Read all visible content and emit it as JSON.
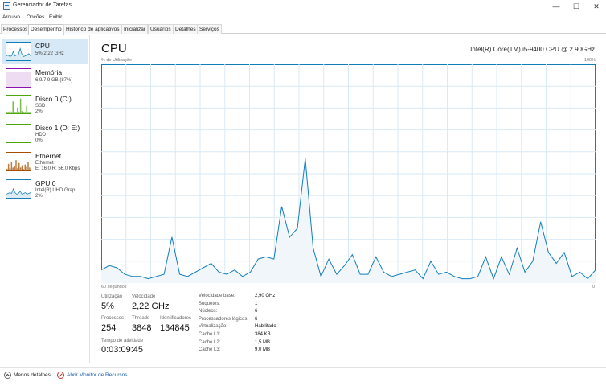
{
  "window": {
    "title": "Gerenciador de Tarefas",
    "controls": {
      "minimize": "—",
      "maximize": "☐",
      "close": "✕"
    }
  },
  "menu": [
    "Arquivo",
    "Opções",
    "Exibir"
  ],
  "tabs": [
    "Processos",
    "Desempenho",
    "Histórico de aplicativos",
    "Inicializar",
    "Usuários",
    "Detalhes",
    "Serviços"
  ],
  "active_tab": "Desempenho",
  "sidebar": {
    "items": [
      {
        "name": "CPU",
        "lines": [
          "5% 2,22 GHz"
        ],
        "color": "#117dbb"
      },
      {
        "name": "Memória",
        "lines": [
          "6,9/7,9 GB (87%)"
        ],
        "color": "#8b12ae"
      },
      {
        "name": "Disco 0 (C:)",
        "lines": [
          "SSD",
          "2%"
        ],
        "color": "#4da60c"
      },
      {
        "name": "Disco 1 (D: E:)",
        "lines": [
          "HDD",
          "0%"
        ],
        "color": "#4da60c"
      },
      {
        "name": "Ethernet",
        "lines": [
          "Ethernet",
          "E: 16,0  R: 56,0 Kbps"
        ],
        "color": "#a74f01"
      },
      {
        "name": "GPU 0",
        "lines": [
          "Intel(R) UHD Grap...",
          "2%"
        ],
        "color": "#1a7fb5"
      }
    ]
  },
  "main": {
    "title": "CPU",
    "cpu_model": "Intel(R) Core(TM) i5-9400 CPU @ 2.90GHz",
    "graph_label": "% de Utilização",
    "graph_max": "100%",
    "graph_min": "0",
    "time_label": "60 segundos",
    "graph_color": "#117dbb"
  },
  "chart_data": {
    "type": "area",
    "xlabel": "60 segundos",
    "ylabel": "% de Utilização",
    "ylim": [
      0,
      100
    ],
    "values": [
      6,
      8,
      7,
      4,
      3,
      3,
      2,
      3,
      4,
      21,
      4,
      3,
      5,
      7,
      9,
      5,
      4,
      6,
      3,
      5,
      11,
      12,
      11,
      35,
      21,
      25,
      57,
      16,
      3,
      11,
      4,
      8,
      13,
      4,
      4,
      12,
      5,
      3,
      4,
      5,
      6,
      2,
      10,
      4,
      5,
      3,
      2,
      2,
      3,
      12,
      2,
      12,
      4,
      16,
      5,
      10,
      28,
      14,
      9,
      14,
      3,
      5,
      2,
      6
    ]
  },
  "stats": {
    "utilizacao": {
      "label": "Utilização",
      "value": "5%"
    },
    "velocidade": {
      "label": "Velocidade",
      "value": "2,22 GHz"
    },
    "processos": {
      "label": "Processos",
      "value": "254"
    },
    "threads": {
      "label": "Threads",
      "value": "3848"
    },
    "identificadores": {
      "label": "Identificadores",
      "value": "134845"
    },
    "tempo": {
      "label": "Tempo de atividade",
      "value": "0:03:09:45"
    }
  },
  "specs": [
    {
      "key": "Velocidade base:",
      "value": "2,90 GHz"
    },
    {
      "key": "Soquetes:",
      "value": "1"
    },
    {
      "key": "Núcleos:",
      "value": "6"
    },
    {
      "key": "Processadores lógicos:",
      "value": "6"
    },
    {
      "key": "Virtualização:",
      "value": "Habilitado"
    },
    {
      "key": "Cache L1:",
      "value": "384 KB"
    },
    {
      "key": "Cache L2:",
      "value": "1,5 MB"
    },
    {
      "key": "Cache L3:",
      "value": "9,0 MB"
    }
  ],
  "footer": {
    "less_details": "Menos detalhes",
    "resource_monitor": "Abrir Monitor de Recursos"
  }
}
